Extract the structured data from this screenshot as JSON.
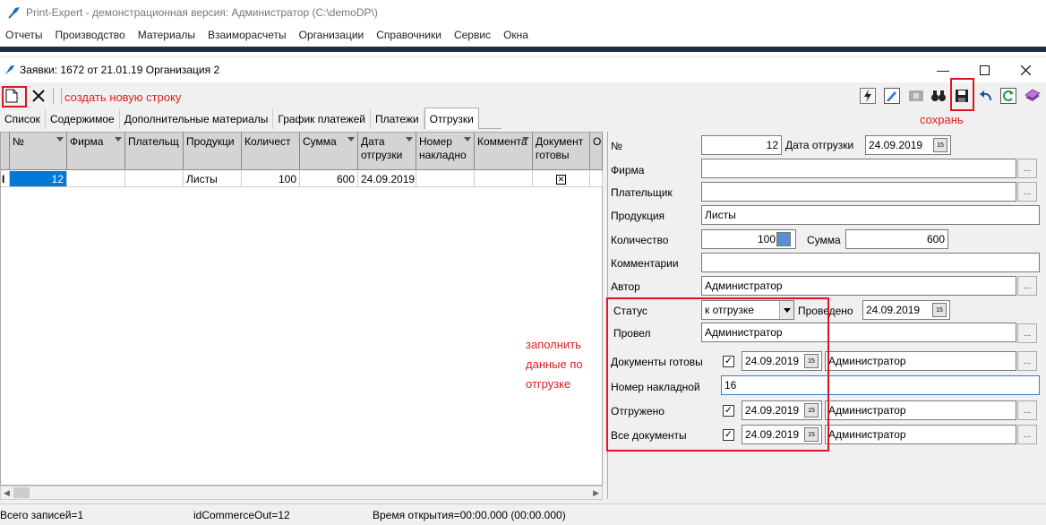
{
  "app": {
    "title": "Print-Expert - демонстрационная версия: Администратор (C:\\demoDP\\)",
    "menu": [
      "Отчеты",
      "Производство",
      "Материалы",
      "Взаиморасчеты",
      "Организации",
      "Справочники",
      "Сервис",
      "Окна"
    ]
  },
  "window": {
    "title": "Заявки: 1672 от 21.01.19  Организация 2"
  },
  "annotations": {
    "new_row": "создать новую строку",
    "save": "сохрань",
    "fill": [
      "заполнить",
      "данные по",
      "отгрузке"
    ]
  },
  "tabs": [
    "Список",
    "Содержимое",
    "Дополнительные материалы",
    "График платежей",
    "Платежи",
    "Отгрузки"
  ],
  "grid": {
    "headers": [
      {
        "text": "№"
      },
      {
        "text": "Фирма"
      },
      {
        "text": "Плательщ"
      },
      {
        "text": "Продукци"
      },
      {
        "text": "Количест"
      },
      {
        "text": "Сумма"
      },
      {
        "text": "Дата\nотгрузки"
      },
      {
        "text": "Номер\nнакладно"
      },
      {
        "text": "Коммента"
      },
      {
        "text": "Документ\nготовы"
      },
      {
        "text": "О"
      }
    ],
    "row": [
      "12",
      "",
      "",
      "Листы",
      "100",
      "600",
      "24.09.2019",
      "",
      "",
      "✕",
      ""
    ],
    "row_marker": "I"
  },
  "form": {
    "num_label": "№",
    "num_value": "12",
    "ship_date_label": "Дата отгрузки",
    "ship_date_value": "24.09.2019",
    "firm_label": "Фирма",
    "firm_value": "",
    "payer_label": "Плательщик",
    "payer_value": "",
    "product_label": "Продукция",
    "product_value": "Листы",
    "qty_label": "Количество",
    "qty_value": "100",
    "sum_label": "Сумма",
    "sum_value": "600",
    "comment_label": "Комментарии",
    "comment_value": "",
    "author_label": "Автор",
    "author_value": "Администратор",
    "status_label": "Статус",
    "status_value": "к отгрузке",
    "posted_label": "Проведено",
    "posted_value": "24.09.2019",
    "posted_by_label": "Провел",
    "posted_by_value": "Администратор",
    "docs_ready_label": "Документы готовы",
    "docs_ready_date": "24.09.2019",
    "docs_ready_user": "Администратор",
    "invoice_label": "Номер накладной",
    "invoice_value": "16",
    "shipped_label": "Отгружено",
    "shipped_date": "24.09.2019",
    "shipped_user": "Администратор",
    "all_docs_label": "Все документы",
    "all_docs_date": "24.09.2019",
    "all_docs_user": "Администратор",
    "check_mark": "✓",
    "dots": "..."
  },
  "status": {
    "total": "Всего записей=1",
    "id": "idCommerceOut=12",
    "time": "Время открытия=00:00.000 (00:00.000)"
  },
  "colors": {
    "selected_cell": "#0078d7",
    "annotation": "#e0141e",
    "dark_band": "#1f2f44"
  }
}
